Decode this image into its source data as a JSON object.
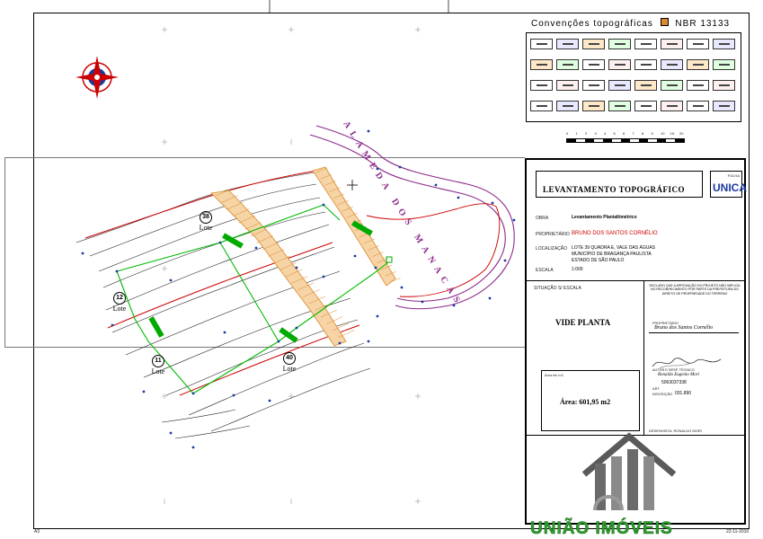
{
  "legend": {
    "title": "Convenções topográficas",
    "norm": "NBR 13133"
  },
  "street": {
    "name": "ALAMEDA DOS MANACÁS"
  },
  "lots": [
    {
      "number": "38",
      "label": "Lote"
    },
    {
      "number": "12",
      "label": "Lote"
    },
    {
      "number": "11",
      "label": "Lote"
    },
    {
      "number": "40",
      "label": "Lote"
    }
  ],
  "title_block": {
    "title": "LEVANTAMENTO TOPOGRÁFICO",
    "folha_label": "FOLHA",
    "folha_value": "UNICA",
    "obra_label": "OBRA",
    "obra_value": "Levantamento Planialtimétrico",
    "proprietario_label": "PROPRIETÁRIO",
    "proprietario_value": "BRUNO DOS SANTOS CORNÉLIO",
    "localizacao_label": "LOCALIZAÇÃO",
    "localizacao_lines": [
      "LOTE 39 QUADRA E, VALE DAS ÁGUAS",
      "MUNICÍPIO DE BRAGANÇA PAULISTA",
      "ESTADO DE SÃO PAULO"
    ],
    "escala_label": "ESCALA",
    "escala_value": "1:000",
    "situacao_label": "SITUAÇÃO S/ ESCALA",
    "vide_planta": "VIDE PLANTA",
    "area_small": "Área em m2",
    "area_value": "Área: 601,95 m2",
    "declaro": "DECLARO QUE A APROVAÇÃO DO PROJETO NÃO IMPLICA NO RECONHECIMENTO POR PARTE DA PREFEITURA DO DIREITO DE PROPRIEDADE DO TERRENO",
    "prop_label": "PROPRIETÁRIO",
    "prop_sign": "Bruno dos Santos Cornélio",
    "autor_label": "AUTOR E RESP. TÉCNICO",
    "autor_sign": "Ronaldo Eugenio Mori",
    "crea": "5063037338",
    "art_label": "ART",
    "inscricao_label": "INSCRIÇÃO",
    "inscricao_value": "031.890",
    "desenhista": "DESENHISTA: RONALDO MORI"
  },
  "footer": {
    "date": "22-11-2010",
    "sheet_ref": "A3"
  },
  "watermark": {
    "brand": "UNIÃO IMÓVEIS"
  },
  "scale_bar": {
    "ticks": [
      "0",
      "1",
      "2",
      "3",
      "4",
      "5",
      "6",
      "7",
      "8",
      "9",
      "10",
      "15",
      "20"
    ]
  },
  "colors": {
    "contour": "#222222",
    "contour_red": "#cc0000",
    "boundary_green": "#00bb00",
    "street_purple": "#8a2a8a",
    "hatch_orange": "#d98a2a",
    "title_blue": "#1a3aa0",
    "brand_green": "#2fa02f"
  }
}
